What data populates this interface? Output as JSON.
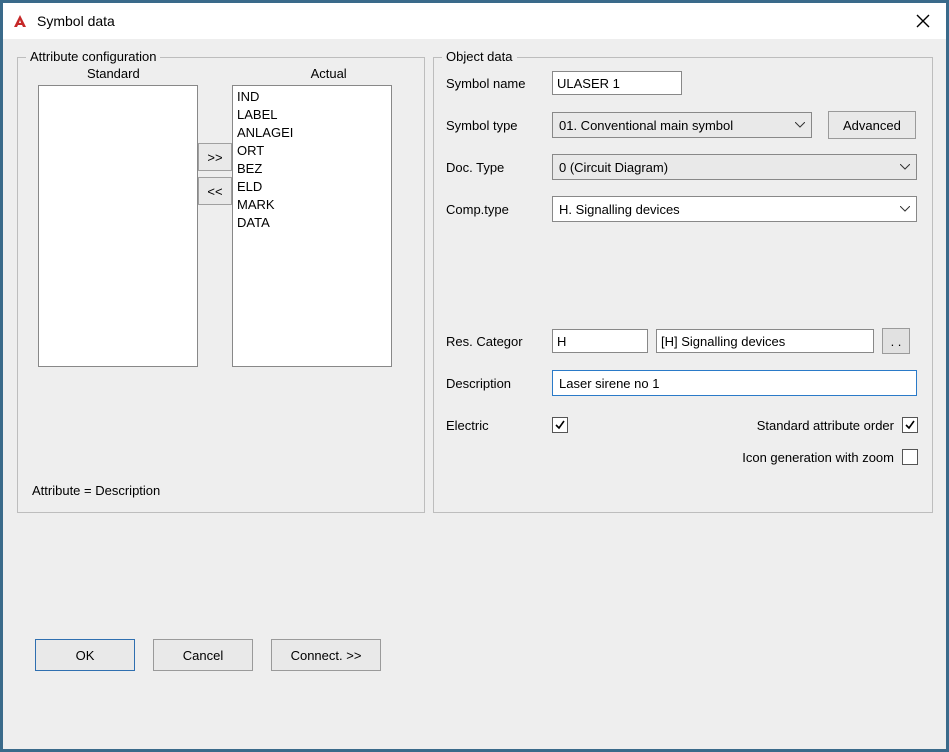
{
  "title": "Symbol data",
  "attr_group": {
    "legend": "Attribute configuration",
    "standard_header": "Standard",
    "actual_header": "Actual",
    "standard_items": [],
    "actual_items": [
      "IND",
      "LABEL",
      "ANLAGEI",
      "ORT",
      "BEZ",
      "ELD",
      "MARK",
      "DATA"
    ],
    "move_right": ">>",
    "move_left": "<<",
    "status": "Attribute = Description"
  },
  "obj_group": {
    "legend": "Object data",
    "labels": {
      "symbol_name": "Symbol name",
      "symbol_type": "Symbol type",
      "doc_type": "Doc. Type",
      "comp_type": "Comp.type",
      "res_categor": "Res. Categor",
      "description": "Description",
      "electric": "Electric",
      "std_attr_order": "Standard attribute order",
      "icon_gen_zoom": "Icon generation with zoom"
    },
    "values": {
      "symbol_name": "ULASER 1",
      "symbol_type": "01. Conventional main symbol",
      "doc_type": "0 (Circuit Diagram)",
      "comp_type": "H. Signalling devices",
      "res_cat_code": "H",
      "res_cat_name": "[H] Signalling devices",
      "description": "Laser sirene no 1",
      "electric_checked": true,
      "std_attr_checked": true,
      "icon_gen_checked": false
    },
    "buttons": {
      "advanced": "Advanced",
      "browse": ". ."
    }
  },
  "footer": {
    "ok": "OK",
    "cancel": "Cancel",
    "connect": "Connect. >>"
  }
}
